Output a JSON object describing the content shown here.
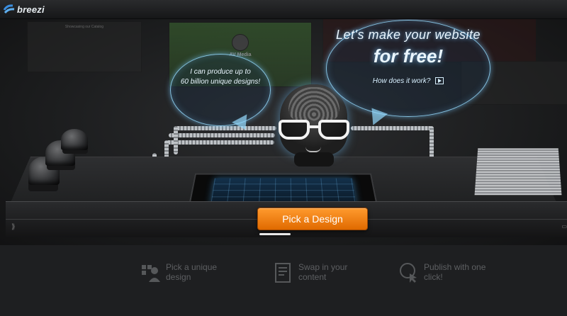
{
  "header": {
    "logo_text": "breezi",
    "logo_icon": "breezi-swirl-icon"
  },
  "background_screens": {
    "left_title": "Showcasing our Catalog",
    "center_title": "AV Media"
  },
  "speech_small": {
    "line1": "I can produce up to",
    "line2": "60 billion unique designs!"
  },
  "speech_big": {
    "headline": "Let's make your website",
    "emphasis": "for free!",
    "link_label": "How does it work?",
    "link_icon": "play-icon"
  },
  "cta": {
    "label": "Pick a Design",
    "color": "#f28a12"
  },
  "steps": [
    {
      "icon": "person-grid-icon",
      "label": "Pick a unique design"
    },
    {
      "icon": "content-document-icon",
      "label": "Swap in your content"
    },
    {
      "icon": "globe-cursor-icon",
      "label": "Publish with one click!"
    }
  ],
  "colors": {
    "glow": "#96dcff",
    "background": "#1c1d1f"
  }
}
